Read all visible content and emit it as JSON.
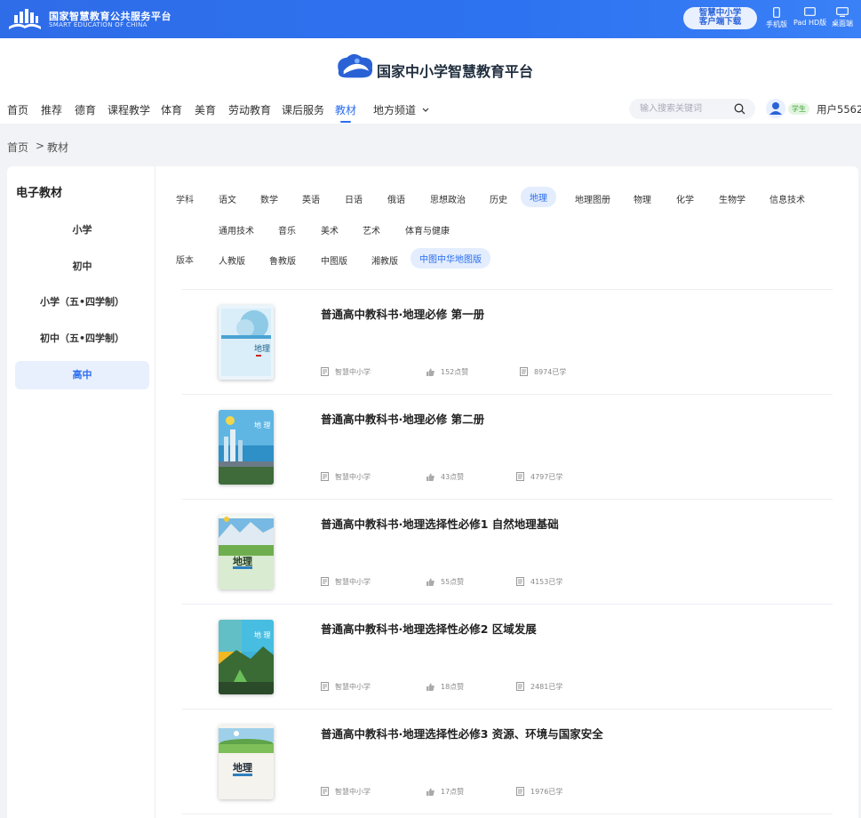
{
  "top_bar": {
    "org_name": "国家智慧教育公共服务平台",
    "org_name_en": "SMART EDUCATION OF CHINA",
    "client_download_line1": "智慧中小学",
    "client_download_line2": "客户端下载",
    "devices": [
      "手机版",
      "Pad HD版",
      "桌面端"
    ]
  },
  "header": {
    "brand": "国家中小学智慧教育平台",
    "nav": [
      "首页",
      "推荐",
      "德育",
      "课程教学",
      "体育",
      "美育",
      "劳动教育",
      "课后服务",
      "教材",
      "地方频道"
    ],
    "active_nav": "教材",
    "search_placeholder": "输入搜索关键词",
    "role": "学生",
    "username": "用户5562"
  },
  "breadcrumb": {
    "home": "首页",
    "separator": ">",
    "current": "教材"
  },
  "sidebar": {
    "title": "电子教材",
    "items": [
      "小学",
      "初中",
      "小学（五•四学制）",
      "初中（五•四学制）",
      "高中"
    ],
    "active": "高中"
  },
  "filters": {
    "subject_label": "学科",
    "subjects": [
      "语文",
      "数学",
      "英语",
      "日语",
      "俄语",
      "思想政治",
      "历史",
      "地理",
      "地理图册",
      "物理",
      "化学",
      "生物学",
      "信息技术",
      "通用技术",
      "音乐",
      "美术",
      "艺术",
      "体育与健康"
    ],
    "active_subject": "地理",
    "edition_label": "版本",
    "editions": [
      "人教版",
      "鲁教版",
      "中图版",
      "湘教版",
      "中图中华地图版"
    ],
    "active_edition": "中图中华地图版"
  },
  "books": [
    {
      "title": "普通高中教科书·地理必修 第一册",
      "publisher": "智慧中小学",
      "likes": "152点赞",
      "learned": "8974已学"
    },
    {
      "title": "普通高中教科书·地理必修 第二册",
      "publisher": "智慧中小学",
      "likes": "43点赞",
      "learned": "4797已学"
    },
    {
      "title": "普通高中教科书·地理选择性必修1 自然地理基础",
      "publisher": "智慧中小学",
      "likes": "55点赞",
      "learned": "4153已学"
    },
    {
      "title": "普通高中教科书·地理选择性必修2 区域发展",
      "publisher": "智慧中小学",
      "likes": "18点赞",
      "learned": "2481已学"
    },
    {
      "title": "普通高中教科书·地理选择性必修3 资源、环境与国家安全",
      "publisher": "智慧中小学",
      "likes": "17点赞",
      "learned": "1976已学"
    }
  ],
  "cover_texts": {
    "geography": "地理",
    "geography_spaced": "地 理"
  },
  "colors": {
    "primary": "#2a6df0",
    "top_bar": "#2f6ce8",
    "active_bg": "#e3edfd"
  }
}
